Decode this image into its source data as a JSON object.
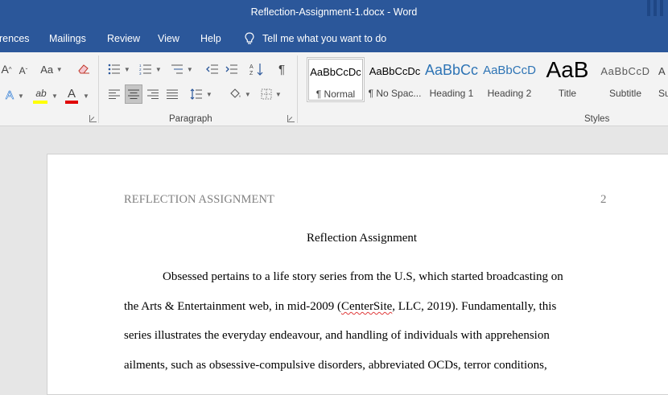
{
  "window": {
    "title": "Reflection-Assignment-1.docx  -  Word"
  },
  "menu_tabs": [
    "rences",
    "Mailings",
    "Review",
    "View",
    "Help"
  ],
  "tell_me": {
    "placeholder": "Tell me what you want to do",
    "icon": "lightbulb-icon"
  },
  "ribbon": {
    "font_group": {
      "grow_label": "A",
      "shrink_label": "A",
      "change_case_label": "Aa",
      "text_effects_label": "A",
      "highlight_label": "ab",
      "highlight_color": "#ffff00",
      "font_color_label": "A",
      "font_color": "#e00000"
    },
    "paragraph_group": {
      "label": "Paragraph"
    },
    "styles_group": {
      "label": "Styles",
      "items": [
        {
          "preview": "AaBbCcDc",
          "label": "¶ Normal",
          "color": "#000000",
          "selected": true
        },
        {
          "preview": "AaBbCcDc",
          "label": "¶ No Spac...",
          "color": "#000000"
        },
        {
          "preview": "AaBbCc",
          "label": "Heading 1",
          "color": "#2e74b5"
        },
        {
          "preview": "AaBbCcD",
          "label": "Heading 2",
          "color": "#2e74b5"
        },
        {
          "preview": "AaB",
          "label": "Title",
          "color": "#000000"
        },
        {
          "preview": "AaBbCcD",
          "label": "Subtitle",
          "color": "#5a5a5a"
        },
        {
          "preview": "A",
          "label": "Su",
          "color": "#404040"
        }
      ]
    }
  },
  "document": {
    "header_title": "REFLECTION ASSIGNMENT",
    "page_number": "2",
    "title": "Reflection Assignment",
    "lines": [
      "Obsessed pertains to a life story series from the U.S, which started broadcasting on",
      "the Arts & Entertainment web, in mid-2009 (",
      "CenterSite",
      ", LLC, 2019). Fundamentally, this",
      "series illustrates the everyday endeavour, and handling of individuals with apprehension",
      "ailments, such as obsessive-compulsive disorders, abbreviated OCDs, terror conditions,"
    ]
  }
}
